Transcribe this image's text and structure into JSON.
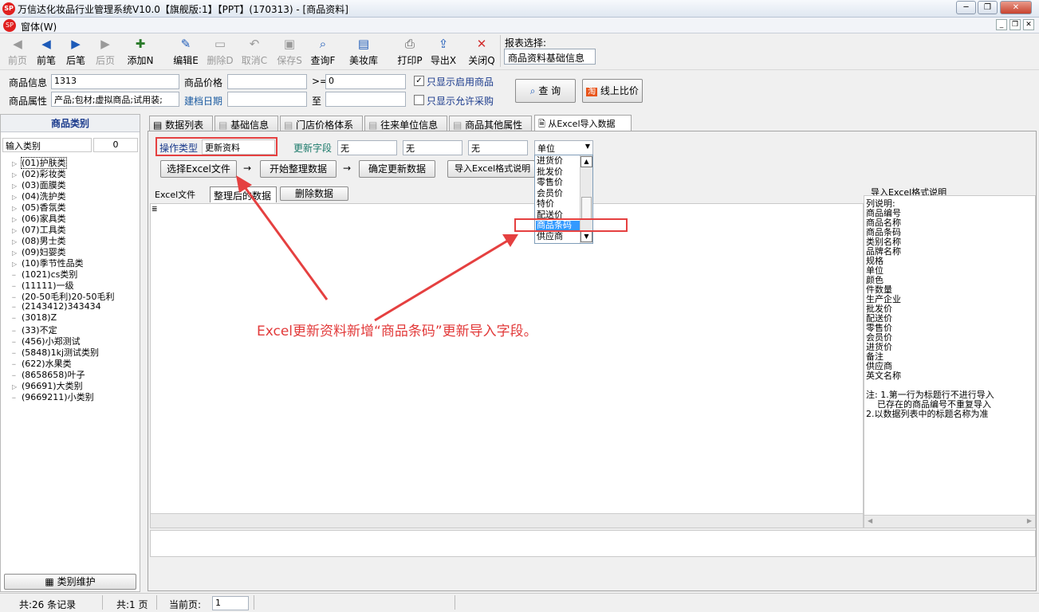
{
  "window": {
    "title": "万信达化妆品行业管理系统V10.0【旗舰版:1】【PPT】(170313) - [商品资料]",
    "menu_label": "窗体(W)",
    "logo_text": "SP"
  },
  "toolbar": {
    "buttons": [
      {
        "label": "前页",
        "icon": "first-page-icon",
        "enabled": false
      },
      {
        "label": "前笔",
        "icon": "prev-record-icon",
        "enabled": true
      },
      {
        "label": "后笔",
        "icon": "next-record-icon",
        "enabled": true
      },
      {
        "label": "后页",
        "icon": "last-page-icon",
        "enabled": false
      },
      {
        "label": "添加N",
        "icon": "add-icon",
        "enabled": true
      },
      {
        "label": "编辑E",
        "icon": "edit-icon",
        "enabled": true
      },
      {
        "label": "删除D",
        "icon": "delete-icon",
        "enabled": false
      },
      {
        "label": "取消C",
        "icon": "undo-icon",
        "enabled": false
      },
      {
        "label": "保存S",
        "icon": "save-icon",
        "enabled": false
      },
      {
        "label": "查询F",
        "icon": "query-icon",
        "enabled": true
      },
      {
        "label": "美妆库",
        "icon": "library-icon",
        "enabled": true
      },
      {
        "label": "打印P",
        "icon": "print-icon",
        "enabled": true
      },
      {
        "label": "导出X",
        "icon": "export-icon",
        "enabled": true
      },
      {
        "label": "关闭Q",
        "icon": "close-icon",
        "enabled": true
      }
    ],
    "report_label": "报表选择:",
    "report_value": "商品资料基础信息"
  },
  "filters": {
    "product_info_label": "商品信息",
    "product_info_value": "1313",
    "price_label": "商品价格",
    "price_from": "",
    "price_op": ">=",
    "price_to": "0",
    "only_enabled_label": "只显示启用商品",
    "only_enabled_checked": true,
    "attr_label": "商品属性",
    "attr_value": "产品;包材;虚拟商品;试用装;",
    "created_label": "建档日期",
    "created_from": "",
    "to_label": "至",
    "created_to": "",
    "only_purchase_label": "只显示允许采购",
    "only_purchase_checked": false,
    "query_button": "查  询",
    "online_compare_button": "线上比价"
  },
  "category_panel": {
    "title": "商品类别",
    "search_placeholder": "输入类别",
    "search_count": "0",
    "items": [
      {
        "label": "(01)护肤类",
        "expandable": true
      },
      {
        "label": "(02)彩妆类",
        "expandable": true
      },
      {
        "label": "(03)面膜类",
        "expandable": true
      },
      {
        "label": "(04)洗护类",
        "expandable": true
      },
      {
        "label": "(05)香氛类",
        "expandable": true
      },
      {
        "label": "(06)家具类",
        "expandable": true
      },
      {
        "label": "(07)工具类",
        "expandable": true
      },
      {
        "label": "(08)男士类",
        "expandable": true
      },
      {
        "label": "(09)妇婴类",
        "expandable": true
      },
      {
        "label": "(10)季节性品类",
        "expandable": true
      },
      {
        "label": "(1021)cs类别",
        "expandable": false
      },
      {
        "label": "(11111)一级",
        "expandable": false
      },
      {
        "label": "(20-50毛利)20-50毛利",
        "expandable": false
      },
      {
        "label": "(2143412)343434",
        "expandable": false
      },
      {
        "label": "(3018)Z",
        "expandable": false
      },
      {
        "label": "(33)不定",
        "expandable": false
      },
      {
        "label": "(456)小郑测试",
        "expandable": false
      },
      {
        "label": "(5848)1kj测试类别",
        "expandable": false
      },
      {
        "label": "(622)水果类",
        "expandable": false
      },
      {
        "label": "(8658658)叶子",
        "expandable": false
      },
      {
        "label": "(96691)大类别",
        "expandable": true
      },
      {
        "label": "(9669211)小类别",
        "expandable": false
      }
    ],
    "maintain_button": "类别维护"
  },
  "tabs": [
    {
      "label": "数据列表",
      "active": false
    },
    {
      "label": "基础信息",
      "active": false
    },
    {
      "label": "门店价格体系",
      "active": false
    },
    {
      "label": "往来单位信息",
      "active": false
    },
    {
      "label": "商品其他属性",
      "active": false
    },
    {
      "label": "从Excel导入数据",
      "active": true
    }
  ],
  "import": {
    "op_type_label": "操作类型",
    "op_type_value": "更新资料",
    "update_field_label": "更新字段",
    "field1": "无",
    "field2": "无",
    "field3": "无",
    "field4": "单位",
    "select_excel_button": "选择Excel文件",
    "start_button": "开始整理数据",
    "confirm_button": "确定更新数据",
    "format_button": "导入Excel格式说明",
    "arrow1": "→",
    "arrow2": "→",
    "subtabs": [
      "Excel文件",
      "整理后的数据"
    ],
    "delete_button": "删除数据",
    "dropdown_options": [
      "进货价",
      "批发价",
      "零售价",
      "会员价",
      "特价",
      "配送价",
      "商品条码",
      "供应商"
    ],
    "dropdown_selected": "商品条码"
  },
  "format_info": {
    "title": "导入Excel格式说明",
    "lines": [
      "列说明:",
      "商品编号",
      "商品名称",
      "商品条码",
      "类别名称",
      "品牌名称",
      "规格",
      "单位",
      "颜色",
      "件数量",
      "生产企业",
      "批发价",
      "配送价",
      "零售价",
      "会员价",
      "进货价",
      "备注",
      "供应商",
      "英文名称"
    ],
    "notes": [
      "注: 1.第一行为标题行不进行导入",
      "    已存在的商品编号不重复导入",
      "2.以数据列表中的标题名称为准"
    ]
  },
  "annotation": "Excel更新资料新增“商品条码”更新导入字段。",
  "status": {
    "records": "共:26 条记录",
    "pages": "共:1 页",
    "current_label": "当前页:",
    "current_page": "1"
  }
}
